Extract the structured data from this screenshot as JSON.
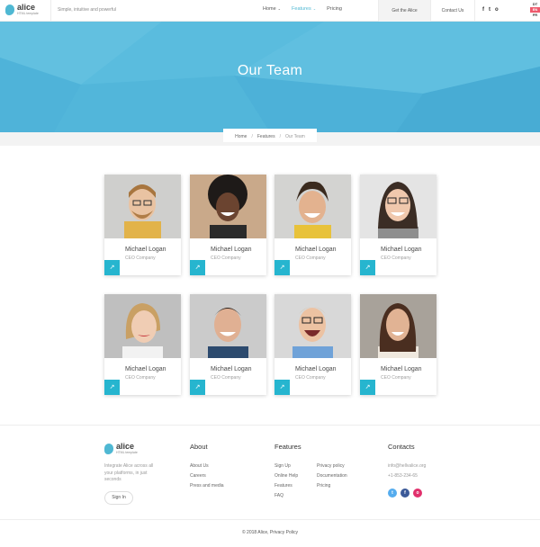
{
  "header": {
    "logo_name": "alice",
    "logo_sub": "HTML template",
    "tagline": "Simple, intuitive and powerful",
    "nav": [
      {
        "label": "Home",
        "has_dropdown": true,
        "active": false
      },
      {
        "label": "Features",
        "has_dropdown": true,
        "active": true
      },
      {
        "label": "Pricing",
        "has_dropdown": false,
        "active": false
      }
    ],
    "get_button": "Get the Alice",
    "contact_link": "Contact Us",
    "social": [
      "f",
      "t",
      "o"
    ],
    "languages": [
      {
        "code": "DT",
        "active": false
      },
      {
        "code": "EN",
        "active": true
      },
      {
        "code": "FR",
        "active": false
      }
    ]
  },
  "hero": {
    "title": "Our Team",
    "breadcrumb": [
      "Home",
      "Features",
      "Our Team"
    ]
  },
  "team": [
    {
      "name": "Michael Logan",
      "role": "CEO Company"
    },
    {
      "name": "Michael Logan",
      "role": "CEO Company"
    },
    {
      "name": "Michael Logan",
      "role": "CEO Company"
    },
    {
      "name": "Michael Logan",
      "role": "CEO Company"
    },
    {
      "name": "Michael Logan",
      "role": "CEO Company"
    },
    {
      "name": "Michael Logan",
      "role": "CEO Company"
    },
    {
      "name": "Michael Logan",
      "role": "CEO Company"
    },
    {
      "name": "Michael Logan",
      "role": "CEO Company"
    }
  ],
  "card_link_icon": "↗",
  "footer": {
    "logo_name": "alice",
    "logo_sub": "HTML template",
    "description": "Integrate Alice across all your platforms, in just seconds",
    "signin": "Sign In",
    "about": {
      "title": "About",
      "links": [
        "About Us",
        "Careers",
        "Press and media"
      ]
    },
    "features": {
      "title": "Features",
      "links_left": [
        "Sign Up",
        "Online Help",
        "Features",
        "FAQ"
      ],
      "links_right": [
        "Privacy policy",
        "Documentation",
        "Pricing"
      ]
    },
    "contacts": {
      "title": "Contacts",
      "email": "info@hellvalice.org",
      "phone": "+1-853-234-65",
      "social": [
        "t",
        "f",
        "o"
      ]
    },
    "copyright": "© 2018 Alice, Privacy Policy"
  },
  "colors": {
    "accent": "#26b5cf",
    "hero": "#56b9dc",
    "lang_active": "#ee5a6d",
    "twitter": "#55acee",
    "facebook": "#3b5998",
    "instagram": "#e1306c"
  },
  "icons": {
    "logo": "drop-logo-icon",
    "dropdown": "chevron-down-icon",
    "card_link": "arrow-up-right-icon"
  }
}
